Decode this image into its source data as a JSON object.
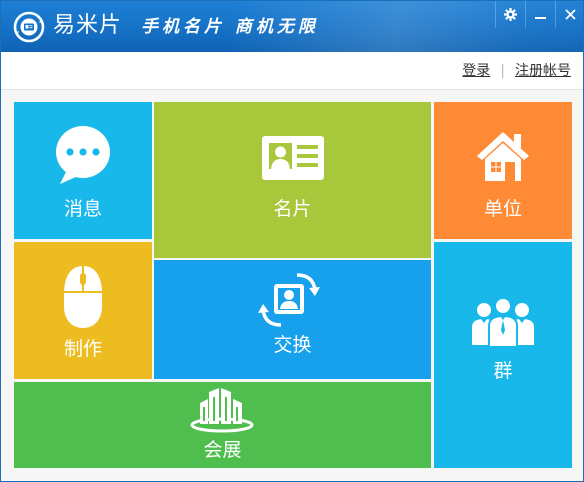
{
  "window": {
    "app_name": "易米片",
    "slogan": "手机名片 商机无限",
    "buttons": {
      "settings": "gear-icon",
      "minimize": "minimize-icon",
      "close": "close-icon"
    }
  },
  "account": {
    "login": "登录",
    "register": "注册帐号"
  },
  "tiles": {
    "messages": {
      "label": "消息",
      "icon": "speech-bubble-icon",
      "color": "#19b8ea"
    },
    "card": {
      "label": "名片",
      "icon": "id-card-icon",
      "color": "#a9c73a"
    },
    "org": {
      "label": "单位",
      "icon": "house-icon",
      "color": "#fe8a35"
    },
    "make": {
      "label": "制作",
      "icon": "mouse-icon",
      "color": "#edbc20"
    },
    "exchange": {
      "label": "交换",
      "icon": "exchange-icon",
      "color": "#17a0ec"
    },
    "group": {
      "label": "群",
      "icon": "people-icon",
      "color": "#19b8ea"
    },
    "expo": {
      "label": "会展",
      "icon": "buildings-icon",
      "color": "#4fbe4f"
    }
  }
}
